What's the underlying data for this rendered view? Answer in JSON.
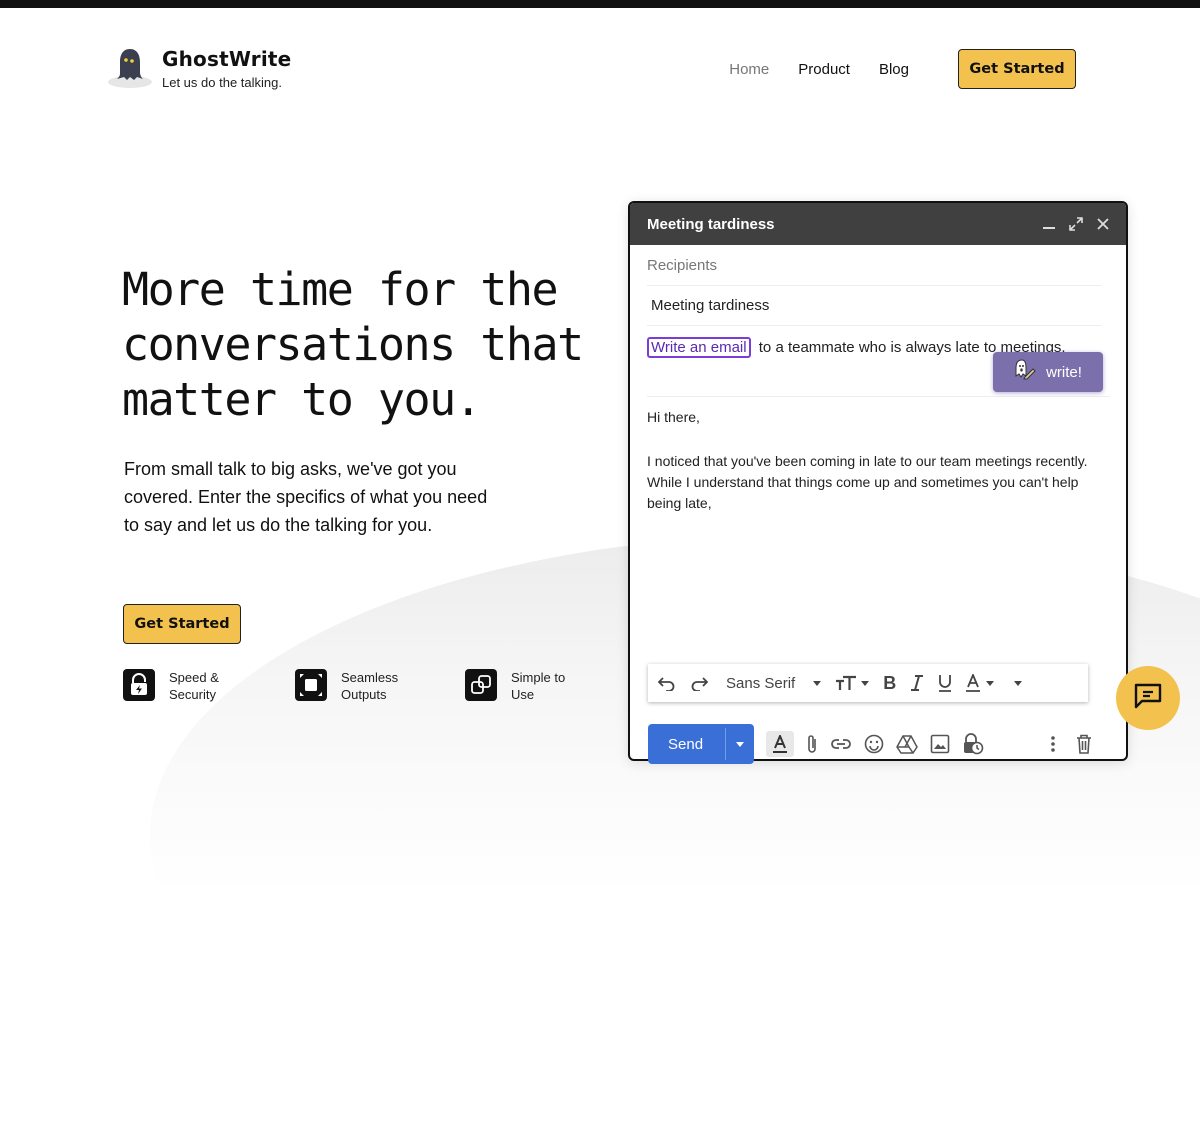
{
  "brand": {
    "name": "GhostWrite",
    "tagline": "Let us do the talking."
  },
  "nav": {
    "items": [
      {
        "label": "Home",
        "active": true
      },
      {
        "label": "Product",
        "active": false
      },
      {
        "label": "Blog",
        "active": false
      }
    ],
    "cta_label": "Get Started"
  },
  "hero": {
    "title_lines": [
      "More time for the",
      "conversations that",
      "matter to you."
    ],
    "description": "From small talk to big asks, we've got you covered. Enter the specifics of what you need to say and let us do the talking for you.",
    "cta_label": "Get Started"
  },
  "features": [
    {
      "icon": "lock-bolt-icon",
      "label": "Speed & Security"
    },
    {
      "icon": "expand-square-icon",
      "label": "Seamless Outputs"
    },
    {
      "icon": "overlap-squares-icon",
      "label": "Simple to Use"
    }
  ],
  "compose": {
    "window_title": "Meeting tardiness",
    "recipients_placeholder": "Recipients",
    "subject": "Meeting tardiness",
    "prompt_tag": "Write an email",
    "prompt_rest": "to a teammate who is always late to meetings.",
    "write_button_label": "write!",
    "body_paragraphs": [
      "Hi there,",
      "I noticed that you've been coming in late to our team meetings recently. While I understand that things come up and sometimes you can't help being late,"
    ],
    "format_bar": {
      "font": "Sans Serif"
    },
    "send_label": "Send"
  },
  "colors": {
    "accent_yellow": "#f3c24e",
    "compose_header": "#404040",
    "write_button": "#7b70ac",
    "send_button": "#3b6fd8",
    "prompt_highlight": "#7a3dd8"
  }
}
